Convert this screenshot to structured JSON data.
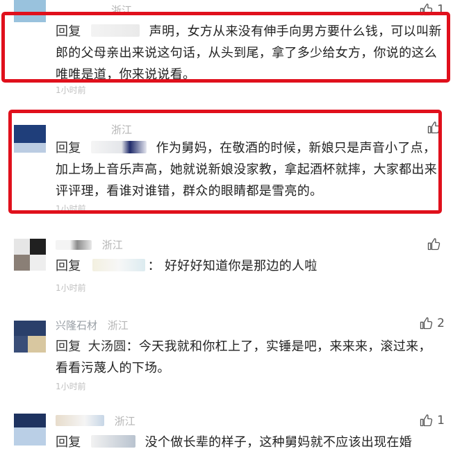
{
  "comments": [
    {
      "name": "",
      "location": "浙江",
      "likes": "1",
      "reply_label": "回复",
      "reply_target": "",
      "separator": "",
      "text": "声明，女方从来没有伸手向男方要什么钱，可以叫新郎的父母亲出来说这句话，从头到尾，拿了多少给女方，你说的这么唯唯是道，你来说说看。",
      "time": "1小时前"
    },
    {
      "name": "",
      "location": "浙江",
      "likes": "",
      "reply_label": "回复",
      "reply_target": "",
      "separator": "",
      "text": "作为舅妈，在敬酒的时候，新娘只是声音小了点，加上场上音乐声高，她就说新娘没家教，拿起酒杯就摔，大家都出来评评理，看谁对谁错，群众的眼睛都是雪亮的。",
      "time": "1小时前"
    },
    {
      "name": "",
      "location": "浙江",
      "likes": "",
      "reply_label": "回复",
      "reply_target": "",
      "separator": "：",
      "text": "好好好知道你是那边的人啦",
      "time": "1小时前"
    },
    {
      "name": "兴隆石材",
      "location": "浙江",
      "likes": "2",
      "reply_label": "回复",
      "reply_target": "大汤圆",
      "separator": "：",
      "text": "今天我就和你杠上了，实锤是吧，来来来，滚过来，看看污蔑人的下场。",
      "time": "1小时前"
    },
    {
      "name": "",
      "location": "浙江",
      "likes": "1",
      "reply_label": "回复",
      "reply_target": "",
      "separator": "",
      "text": "没个做长辈的样子，这种舅妈就不应该出现在婚",
      "time": ""
    }
  ],
  "colors": {
    "highlight_frame": "#e0101c",
    "meta_text": "#b5b5b5",
    "body_text": "#222222"
  },
  "icons": {
    "like": "thumbs-up-icon"
  }
}
